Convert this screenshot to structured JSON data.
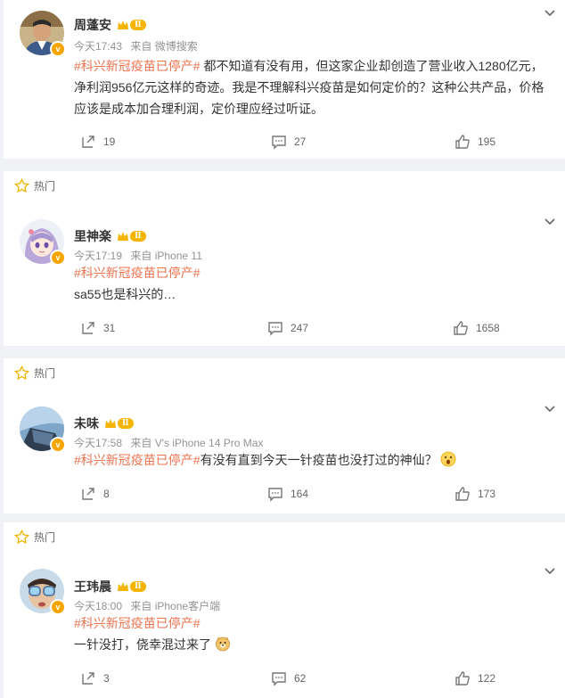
{
  "posts": [
    {
      "hot_label": "",
      "name": "周蓬安",
      "level": "Ⅱ",
      "time": "今天17:43",
      "source": "来自 微博搜索",
      "hashtag": "#科兴新冠疫苗已停产#",
      "text": " 都不知道有没有用，但这家企业却创造了营业收入1280亿元，净利润956亿元这样的奇迹。我是不理解科兴疫苗是如何定价的？这种公共产品，价格应该是成本加合理利润，定价理应经过听证。",
      "reposts": "19",
      "comments": "27",
      "likes": "195",
      "avatar_icon": "man-avatar-icon"
    },
    {
      "hot_label": "热门",
      "name": "里神楽",
      "level": "Ⅱ",
      "time": "今天17:19",
      "source": "来自 iPhone 11",
      "hashtag": "#科兴新冠疫苗已停产#",
      "text": "sa55也是科兴的…",
      "reposts": "31",
      "comments": "247",
      "likes": "1658",
      "avatar_icon": "anime-girl-avatar-icon"
    },
    {
      "hot_label": "热门",
      "name": "未味",
      "level": "Ⅱ",
      "time": "今天17:58",
      "source": "来自 V's iPhone 14 Pro Max",
      "hashtag": "#科兴新冠疫苗已停产#",
      "text": "有没有直到今天一针疫苗也没打过的神仙？",
      "reposts": "8",
      "comments": "164",
      "likes": "173",
      "avatar_icon": "car-window-avatar-icon",
      "emoji": "shocked-face-emoji"
    },
    {
      "hot_label": "热门",
      "name": "王玮晨",
      "level": "Ⅱ",
      "time": "今天18:00",
      "source": "来自 iPhone客户端",
      "hashtag": "#科兴新冠疫苗已停产#",
      "text": "一针没打，侥幸混过来了",
      "reposts": "3",
      "comments": "62",
      "likes": "122",
      "avatar_icon": "kid-goggles-avatar-icon",
      "emoji": "doge-emoji"
    }
  ],
  "colors": {
    "hashtag": "#eb7350",
    "level_badge": "#f5b400",
    "verified_badge": "#f7a600",
    "meta": "#939393",
    "background": "#f1f2f5"
  }
}
